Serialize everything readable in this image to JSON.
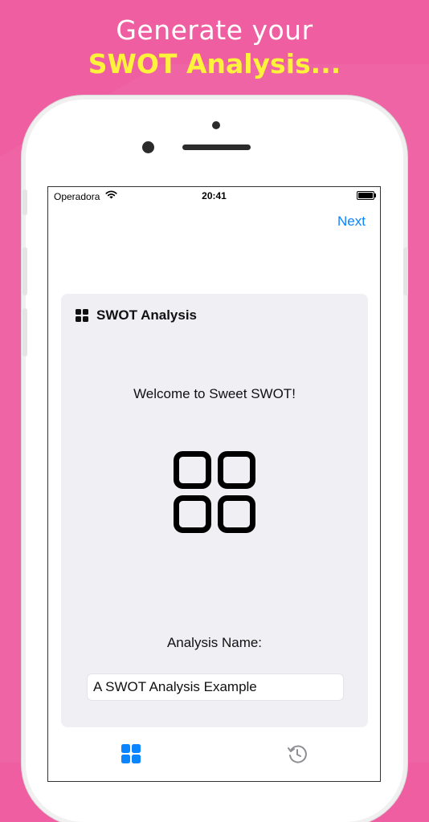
{
  "promo": {
    "line1": "Generate your",
    "line2": "SWOT Analysis..."
  },
  "status_bar": {
    "carrier": "Operadora",
    "time": "20:41"
  },
  "nav": {
    "next_label": "Next"
  },
  "card": {
    "title": "SWOT Analysis",
    "welcome": "Welcome to Sweet SWOT!",
    "name_label": "Analysis Name:",
    "name_value": "A SWOT Analysis Example"
  },
  "tabbar": {
    "items": [
      {
        "icon": "grid-icon",
        "active": true
      },
      {
        "icon": "history-icon",
        "active": false
      }
    ]
  },
  "colors": {
    "background": "#ee5ea0",
    "highlight_text": "#fff23a",
    "accent": "#0a84ff",
    "card_bg": "#efeff4"
  }
}
